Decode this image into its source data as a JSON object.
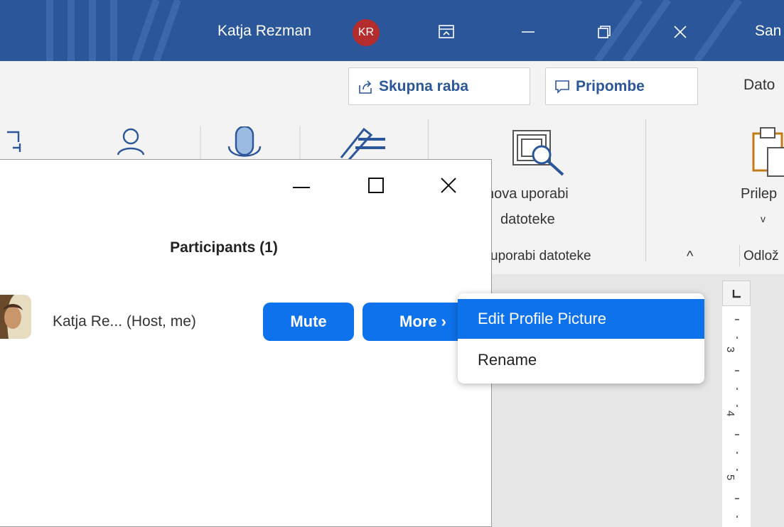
{
  "titlebar": {
    "user_name": "Katja Rezman",
    "avatar_initials": "KR",
    "cut_text": "San",
    "colors": {
      "background": "#2b579a",
      "avatar": "#b42c2c"
    }
  },
  "ribbon": {
    "share_label": "Skupna raba",
    "comments_label": "Pripombe",
    "cut_tab_label": "Dato",
    "reuse_line1": "nova uporabi",
    "reuse_line2": "datoteke",
    "reuse_group_label": "uporabi datoteke",
    "paste_label": "Prilep",
    "clipboard_group_label": "Odlož",
    "collapse_chevron": "^",
    "paste_dropdown": "v"
  },
  "ruler": {
    "numbers": [
      "3",
      "4",
      "5"
    ]
  },
  "participants": {
    "title": "Participants (1)",
    "items": [
      {
        "name": "Katja Re... (Host, me)",
        "mute_label": "Mute",
        "more_label": "More ›"
      }
    ]
  },
  "context_menu": {
    "items": [
      {
        "label": "Edit Profile Picture",
        "highlighted": true
      },
      {
        "label": "Rename",
        "highlighted": false
      }
    ]
  },
  "colors": {
    "zoom_blue": "#0e72ed",
    "word_blue": "#2b579a"
  }
}
